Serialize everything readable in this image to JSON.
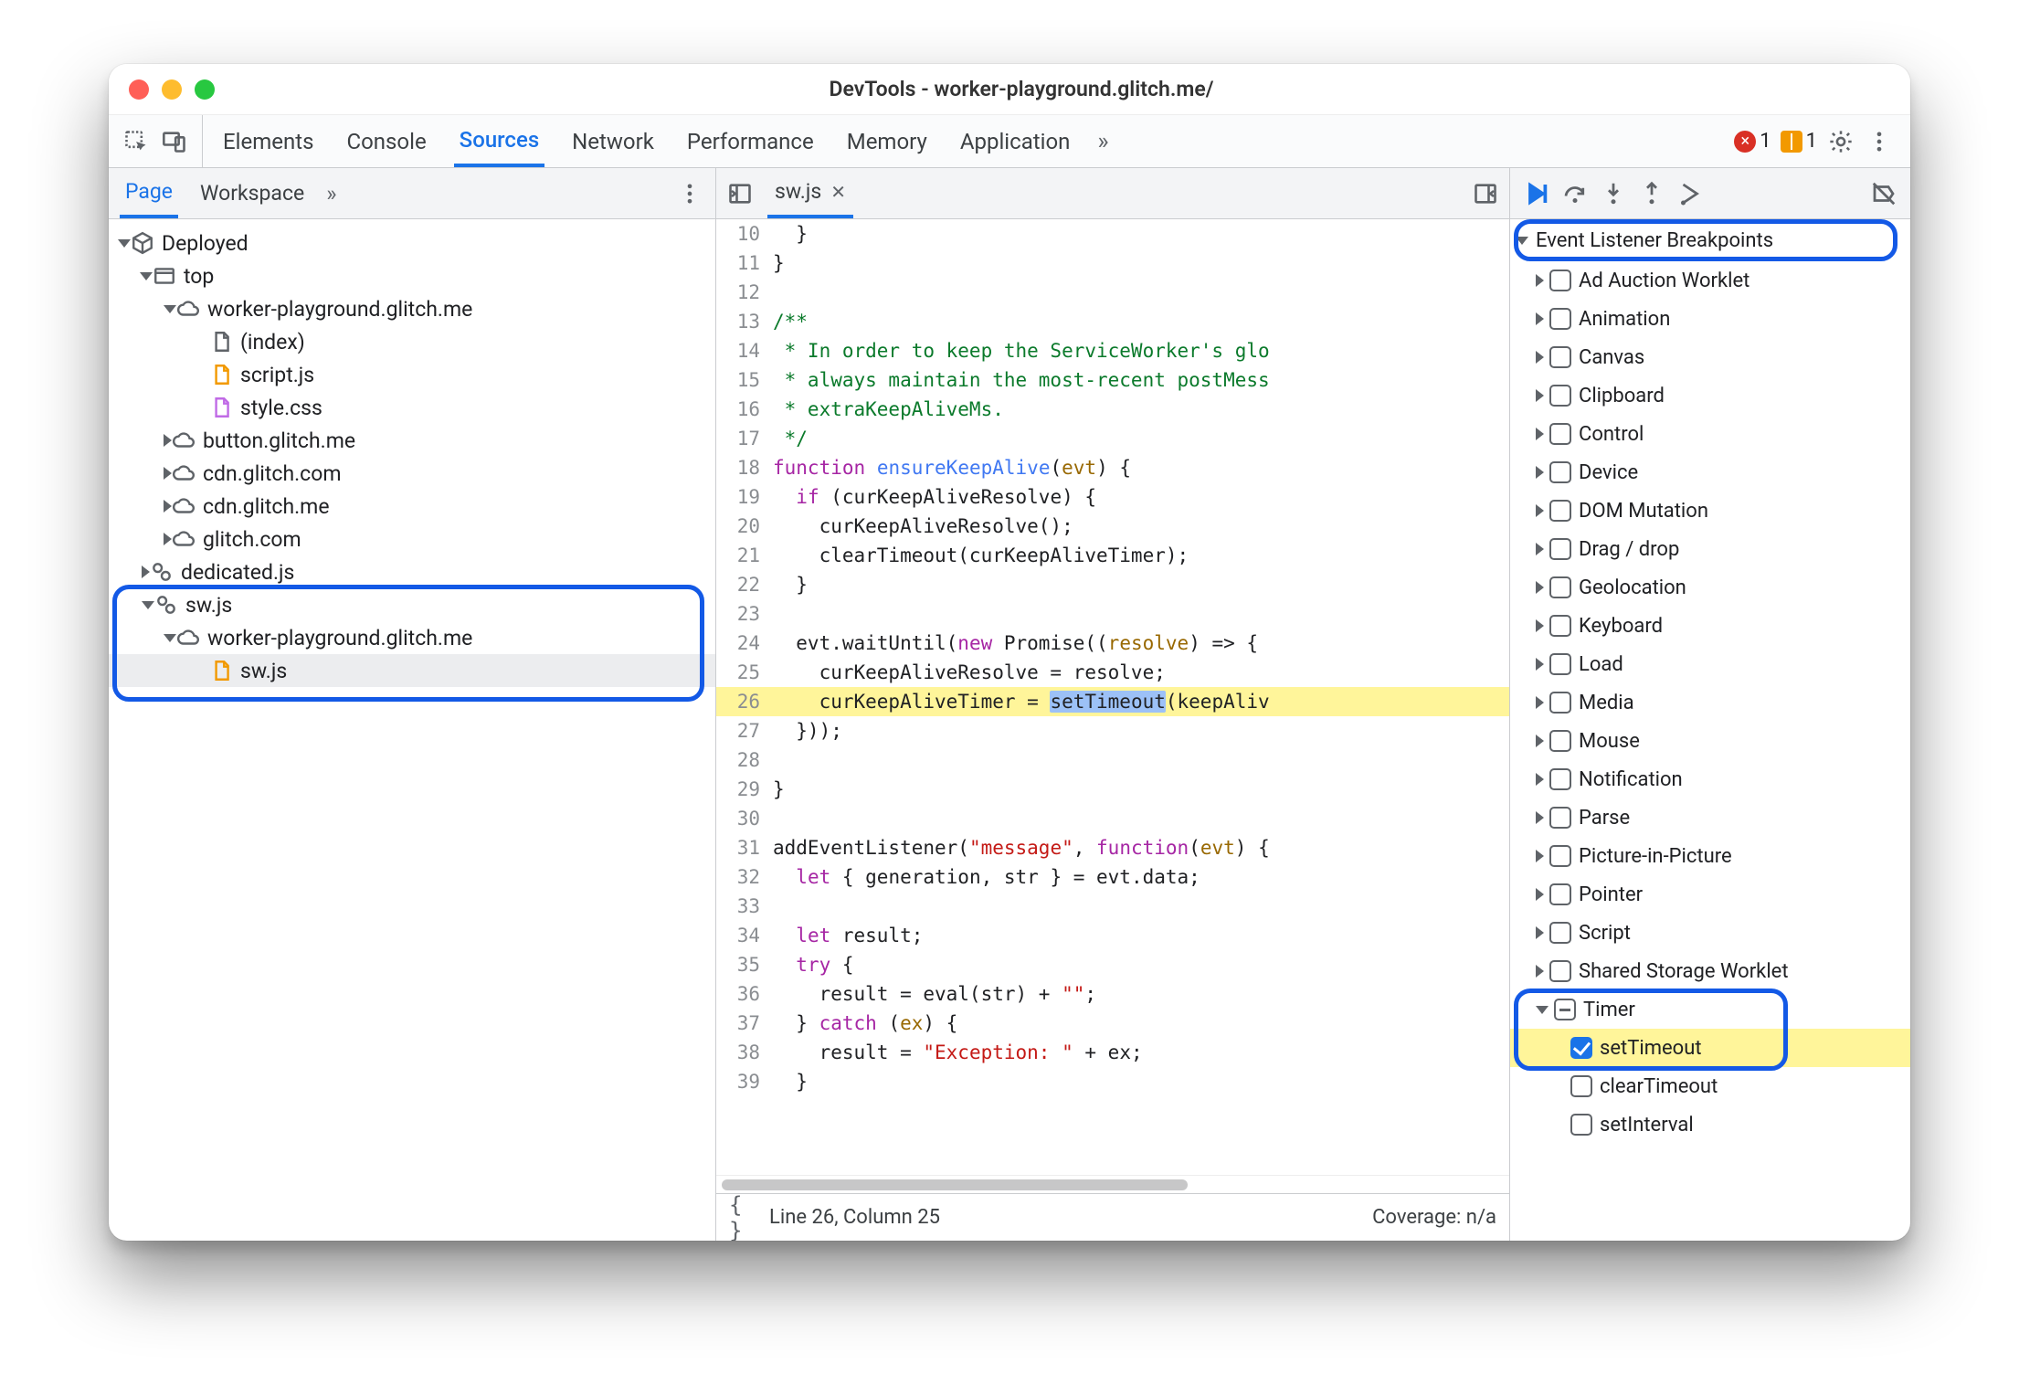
{
  "window": {
    "title": "DevTools - worker-playground.glitch.me/"
  },
  "toolbar": {
    "tabs": [
      "Elements",
      "Console",
      "Sources",
      "Network",
      "Performance",
      "Memory",
      "Application"
    ],
    "activeTab": "Sources",
    "overflow": "»",
    "errors": {
      "count": "1"
    },
    "warnings": {
      "count": "1"
    }
  },
  "sidebar": {
    "tabs": [
      "Page",
      "Workspace"
    ],
    "activeSubTab": "Page",
    "overflow": "»",
    "tree": {
      "root": "Deployed",
      "top": "top",
      "host_wp_me": "worker-playground.glitch.me",
      "files": {
        "index": "(index)",
        "script": "script.js",
        "style": "style.css"
      },
      "hosts": [
        "button.glitch.me",
        "cdn.glitch.com",
        "cdn.glitch.me",
        "glitch.com"
      ],
      "dedicated": "dedicated.js",
      "swjs_group": "sw.js",
      "sw_host": "worker-playground.glitch.me",
      "swjs_file": "sw.js"
    }
  },
  "editor": {
    "openFile": "sw.js",
    "status": {
      "cursor": "Line 26, Column 25",
      "coverage": "Coverage: n/a"
    },
    "lines": [
      {
        "n": 10,
        "html": "  }"
      },
      {
        "n": 11,
        "html": "}"
      },
      {
        "n": 12,
        "html": ""
      },
      {
        "n": 13,
        "html": "<span class='cmt'>/**</span>"
      },
      {
        "n": 14,
        "html": "<span class='cmt'> * In order to keep the ServiceWorker's glo</span>"
      },
      {
        "n": 15,
        "html": "<span class='cmt'> * always maintain the most-recent postMess</span>"
      },
      {
        "n": 16,
        "html": "<span class='cmt'> * extraKeepAliveMs.</span>"
      },
      {
        "n": 17,
        "html": "<span class='cmt'> */</span>"
      },
      {
        "n": 18,
        "html": "<span class='kw'>function</span> <span class='fnname'>ensureKeepAlive</span>(<span class='param'>evt</span>) {"
      },
      {
        "n": 19,
        "html": "  <span class='kw'>if</span> (curKeepAliveResolve) {"
      },
      {
        "n": 20,
        "html": "    curKeepAliveResolve();"
      },
      {
        "n": 21,
        "html": "    clearTimeout(curKeepAliveTimer);"
      },
      {
        "n": 22,
        "html": "  }"
      },
      {
        "n": 23,
        "html": ""
      },
      {
        "n": 24,
        "html": "  evt.waitUntil(<span class='kw'>new</span> Promise((<span class='param'>resolve</span>) =&gt; {"
      },
      {
        "n": 25,
        "html": "    curKeepAliveResolve = resolve;"
      },
      {
        "n": 26,
        "html": "    curKeepAliveTimer = <span class='selWord'>setTimeout</span>(keepAliv",
        "hl": true
      },
      {
        "n": 27,
        "html": "  }));"
      },
      {
        "n": 28,
        "html": ""
      },
      {
        "n": 29,
        "html": "}"
      },
      {
        "n": 30,
        "html": ""
      },
      {
        "n": 31,
        "html": "addEventListener(<span class='str'>&quot;message&quot;</span>, <span class='kw'>function</span>(<span class='param'>evt</span>) {"
      },
      {
        "n": 32,
        "html": "  <span class='kw'>let</span> { generation, str } = evt.data;"
      },
      {
        "n": 33,
        "html": ""
      },
      {
        "n": 34,
        "html": "  <span class='kw'>let</span> result;"
      },
      {
        "n": 35,
        "html": "  <span class='kw'>try</span> {"
      },
      {
        "n": 36,
        "html": "    result = eval(str) + <span class='str'>&quot;&quot;</span>;"
      },
      {
        "n": 37,
        "html": "  } <span class='kw'>catch</span> (<span class='param'>ex</span>) {"
      },
      {
        "n": 38,
        "html": "    result = <span class='str'>&quot;Exception: &quot;</span> + ex;"
      },
      {
        "n": 39,
        "html": "  }"
      }
    ]
  },
  "breakpoints": {
    "sectionTitle": "Event Listener Breakpoints",
    "categories": [
      "Ad Auction Worklet",
      "Animation",
      "Canvas",
      "Clipboard",
      "Control",
      "Device",
      "DOM Mutation",
      "Drag / drop",
      "Geolocation",
      "Keyboard",
      "Load",
      "Media",
      "Mouse",
      "Notification",
      "Parse",
      "Picture-in-Picture",
      "Pointer",
      "Script",
      "Shared Storage Worklet"
    ],
    "timer": {
      "label": "Timer",
      "children": [
        {
          "label": "setTimeout",
          "checked": true,
          "hl": true
        },
        {
          "label": "clearTimeout",
          "checked": false
        },
        {
          "label": "setInterval",
          "checked": false
        }
      ]
    }
  }
}
